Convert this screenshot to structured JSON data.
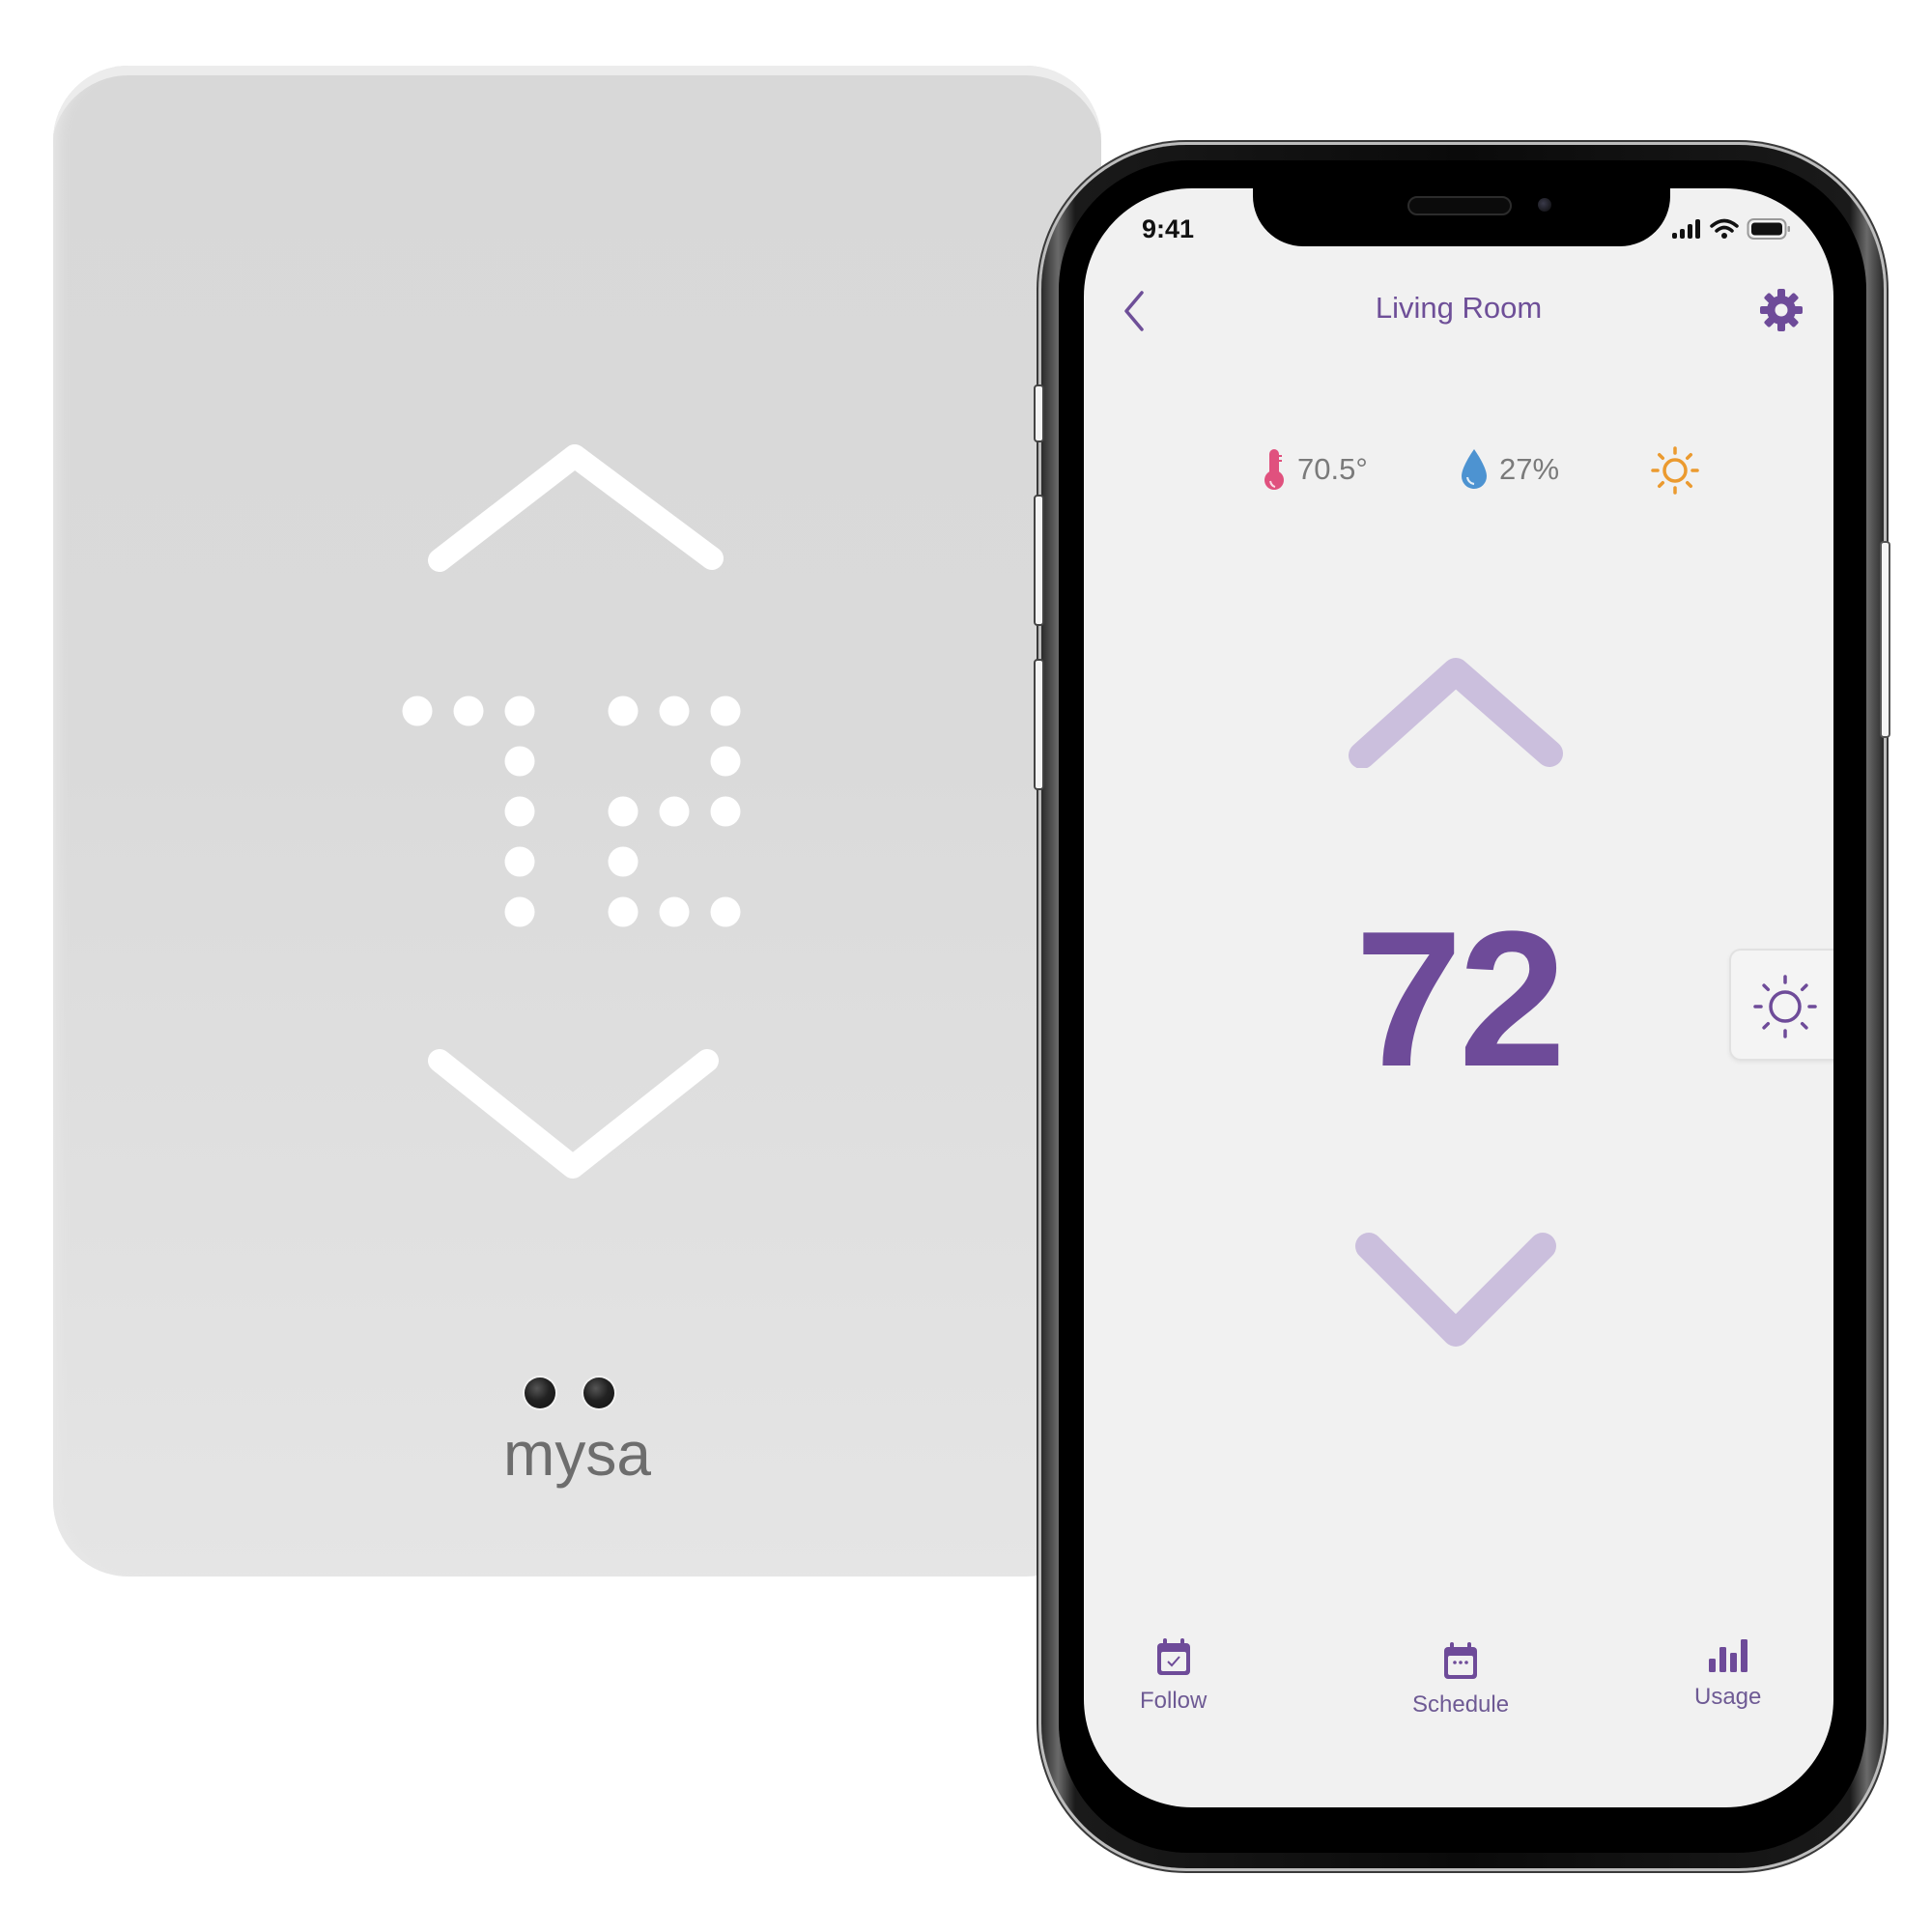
{
  "thermostat": {
    "brand": "mysa",
    "display_value": "72",
    "controls": {
      "up": "chevron-up-icon",
      "down": "chevron-down-icon"
    }
  },
  "phone": {
    "status_bar": {
      "time": "9:41",
      "icons": [
        "cellular-signal-icon",
        "wifi-icon",
        "battery-icon"
      ]
    },
    "header": {
      "title": "Living Room",
      "back_icon": "chevron-left-icon",
      "settings_icon": "gear-icon"
    },
    "readings": {
      "temperature": {
        "icon": "thermometer-icon",
        "value": "70.5°"
      },
      "humidity": {
        "icon": "water-drop-icon",
        "value": "27%"
      },
      "mode": {
        "icon": "sun-icon"
      }
    },
    "setpoint": "72",
    "side_tab": {
      "icon": "sun-icon"
    },
    "tabs": [
      {
        "label": "Follow",
        "icon": "calendar-check-icon"
      },
      {
        "label": "Schedule",
        "icon": "calendar-icon"
      },
      {
        "label": "Usage",
        "icon": "bar-chart-icon"
      }
    ]
  },
  "colors": {
    "brand_purple": "#6e4b99",
    "chevron_light_purple": "#cbbfdd",
    "thermometer_pink": "#e0517e",
    "drop_blue": "#4d93d1",
    "sun_orange": "#eb9a2f",
    "screen_bg": "#f1f1f1",
    "device_bg": "#d8d8d8"
  }
}
